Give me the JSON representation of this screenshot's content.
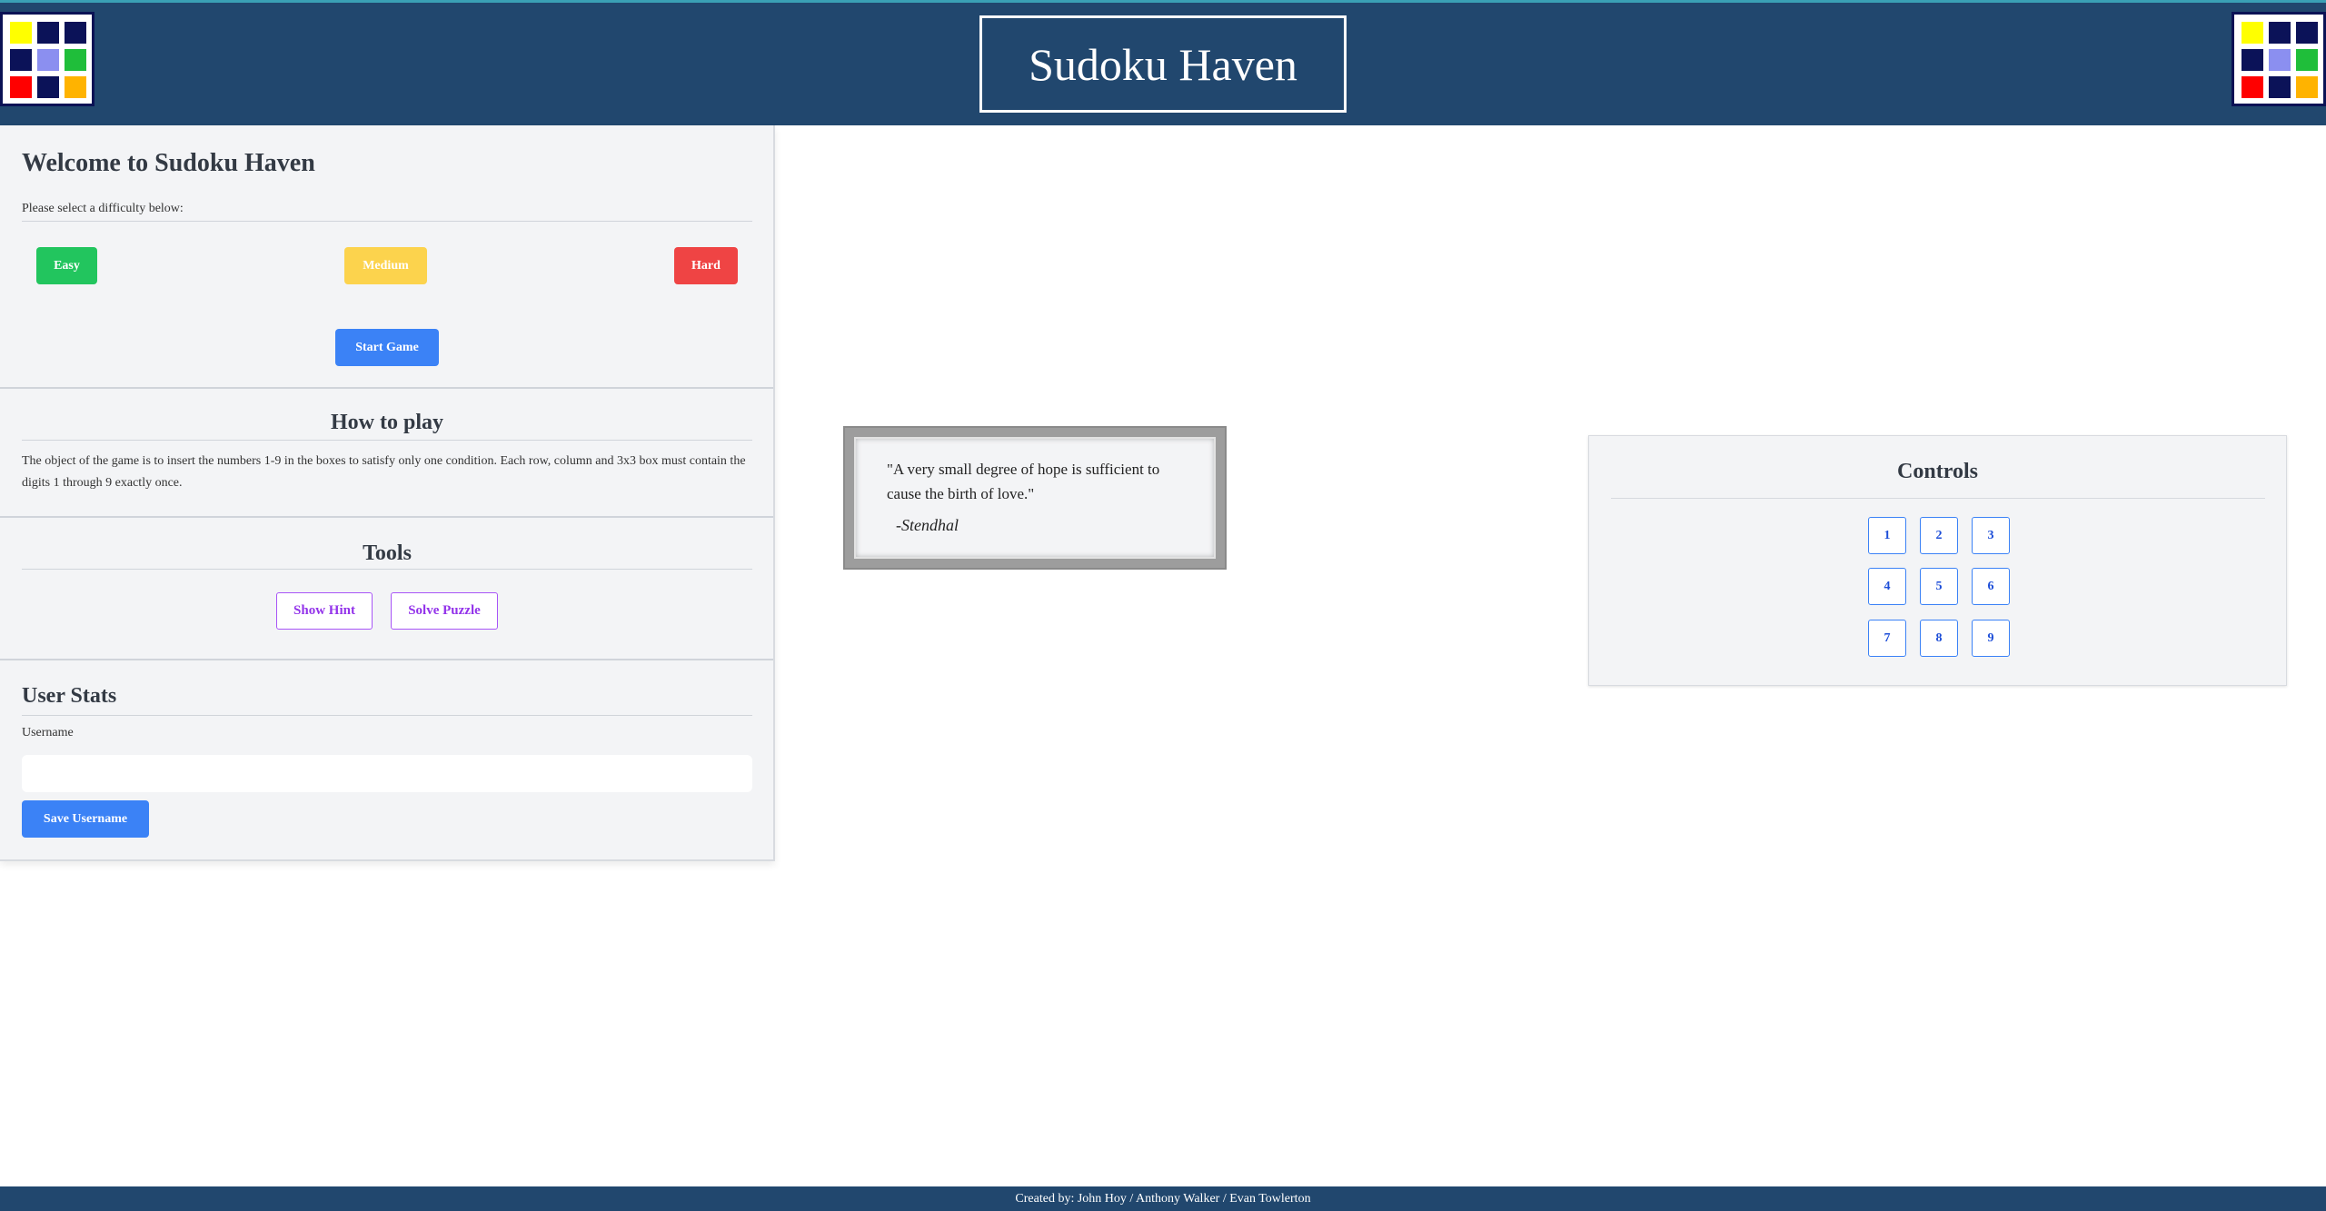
{
  "header": {
    "title": "Sudoku Haven",
    "logo_colors": [
      "#ffff00",
      "#0b1258",
      "#0b1258",
      "#0b1258",
      "#8b8ff0",
      "#1fbe3a",
      "#ff0000",
      "#0b1258",
      "#ffb300"
    ]
  },
  "welcome": {
    "heading": "Welcome to Sudoku Haven",
    "prompt": "Please select a difficulty below:",
    "easy_label": "Easy",
    "medium_label": "Medium",
    "hard_label": "Hard",
    "start_label": "Start Game"
  },
  "how_to_play": {
    "heading": "How to play",
    "text": "The object of the game is to insert the numbers 1-9 in the boxes to satisfy only one condition. Each row, column and 3x3 box must contain the digits 1 through 9 exactly once."
  },
  "tools": {
    "heading": "Tools",
    "hint_label": "Show Hint",
    "solve_label": "Solve Puzzle"
  },
  "user_stats": {
    "heading": "User Stats",
    "username_label": "Username",
    "username_value": "",
    "save_label": "Save Username"
  },
  "quote": {
    "text": "\"A very small degree of hope is sufficient to cause the birth of love.\"",
    "author": "-Stendhal"
  },
  "controls": {
    "heading": "Controls",
    "numbers": [
      "1",
      "2",
      "3",
      "4",
      "5",
      "6",
      "7",
      "8",
      "9"
    ]
  },
  "footer": {
    "credits": "Created by: John Hoy / Anthony Walker / Evan Towlerton"
  },
  "colors": {
    "header_bg": "#21476e",
    "easy": "#22c55e",
    "medium": "#fcd34d",
    "hard": "#ef4444",
    "primary": "#3b82f6",
    "tool_accent": "#a855f7"
  }
}
